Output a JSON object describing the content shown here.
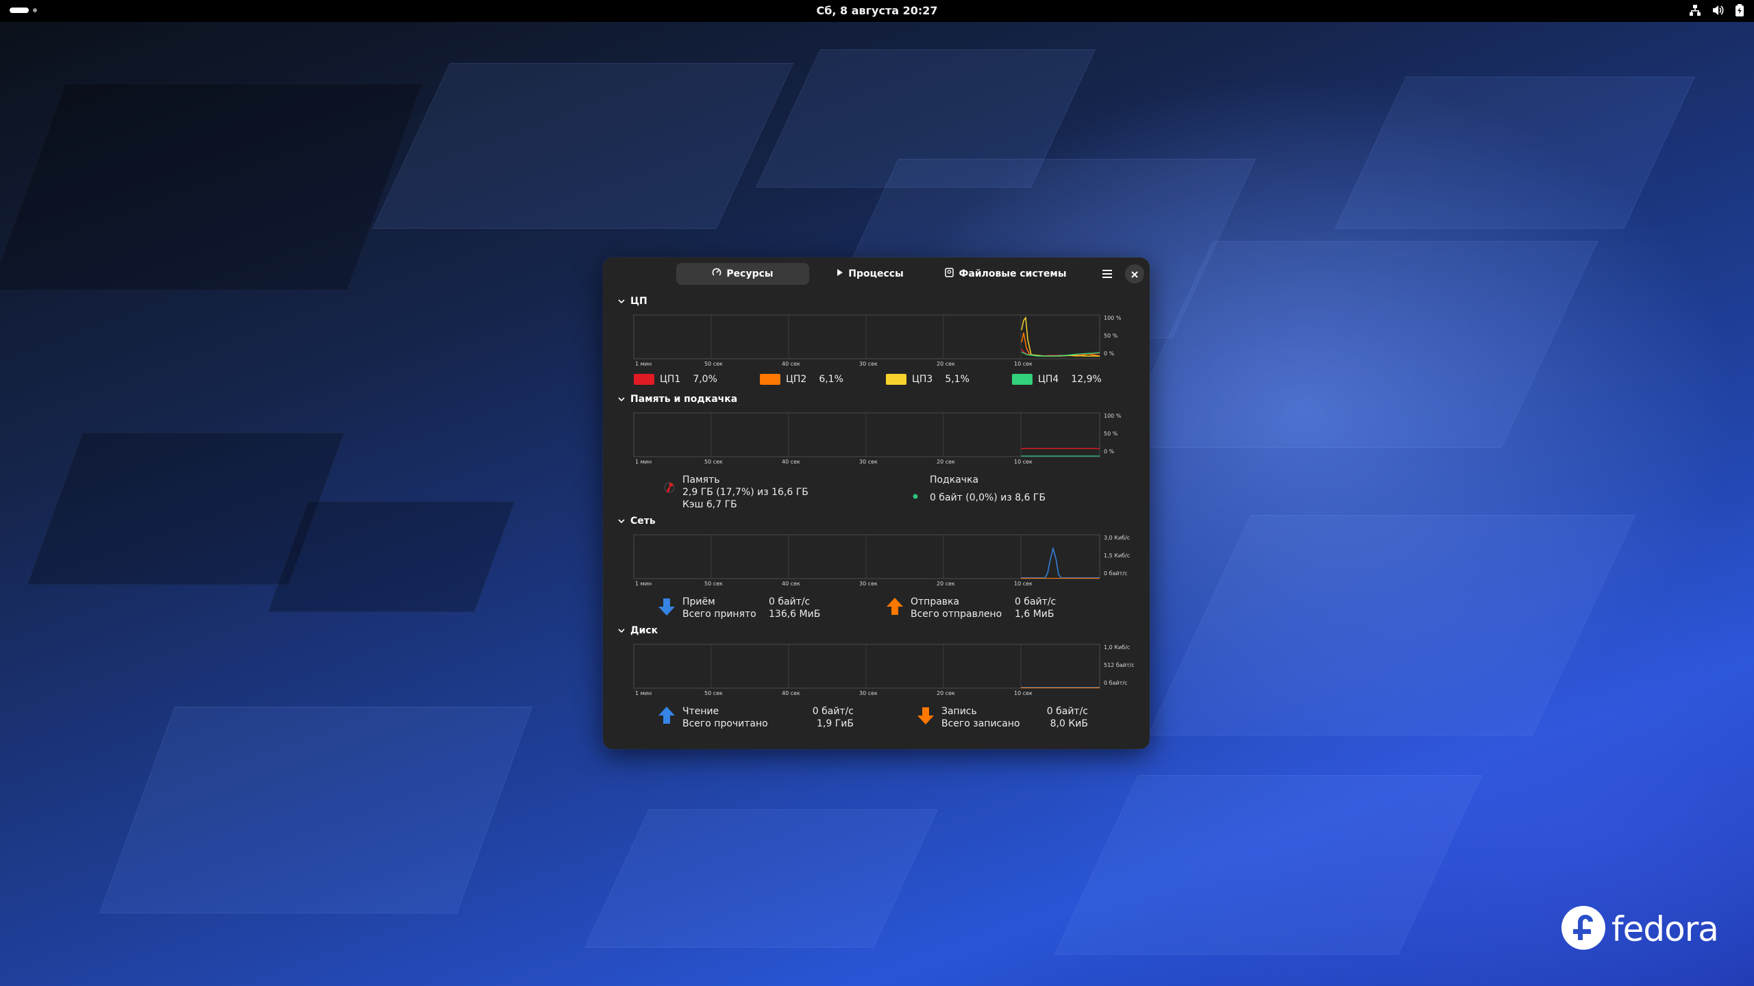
{
  "topbar": {
    "clock": "Сб, 8 августа  20:27"
  },
  "window": {
    "tabs": [
      {
        "label": "Ресурсы",
        "icon": "gauge-icon",
        "active": true
      },
      {
        "label": "Процессы",
        "icon": "play-icon",
        "active": false
      },
      {
        "label": "Файловые системы",
        "icon": "disk-icon",
        "active": false
      }
    ],
    "time_ticks": [
      "1 мин",
      "50 сек",
      "40 сек",
      "30 сек",
      "20 сек",
      "10 сек"
    ],
    "cpu": {
      "title": "ЦП",
      "y_labels": [
        "100 %",
        "50 %",
        "0 %"
      ],
      "cores": [
        {
          "name": "ЦП1",
          "value": "7,0%",
          "color": "#e01b24"
        },
        {
          "name": "ЦП2",
          "value": "6,1%",
          "color": "#ff7800"
        },
        {
          "name": "ЦП3",
          "value": "5,1%",
          "color": "#f6d32d"
        },
        {
          "name": "ЦП4",
          "value": "12,9%",
          "color": "#33d17a"
        }
      ]
    },
    "memory": {
      "title": "Память и подкачка",
      "y_labels": [
        "100 %",
        "50 %",
        "0 %"
      ],
      "mem_label": "Память",
      "mem_used": "2,9 ГБ (17,7%) из 16,6 ГБ",
      "mem_cache": "Кэш 6,7 ГБ",
      "swap_label": "Подкачка",
      "swap_used": "0 байт (0,0%) из 8,6 ГБ"
    },
    "network": {
      "title": "Сеть",
      "y_labels": [
        "3,0 Киб/с",
        "1,5 Киб/с",
        "0 байт/с"
      ],
      "rx_label": "Приём",
      "rx_total_label": "Всего принято",
      "rx_rate": "0 байт/с",
      "rx_total": "136,6 МиБ",
      "tx_label": "Отправка",
      "tx_total_label": "Всего отправлено",
      "tx_rate": "0 байт/с",
      "tx_total": "1,6 МиБ"
    },
    "disk": {
      "title": "Диск",
      "y_labels": [
        "1,0 Киб/с",
        "512 байт/с",
        "0 байт/с"
      ],
      "read_label": "Чтение",
      "read_total_label": "Всего прочитано",
      "read_rate": "0 байт/с",
      "read_total": "1,9 ГиБ",
      "write_label": "Запись",
      "write_total_label": "Всего записано",
      "write_rate": "0 байт/с",
      "write_total": "8,0 КиБ"
    }
  },
  "desktop": {
    "logo_text": "fedora"
  }
}
